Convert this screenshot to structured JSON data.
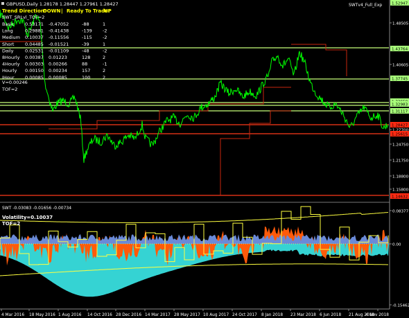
{
  "header": {
    "symbol_line": "GBPUSD,Daily  1.28178 1.28447 1.27961 1.28427",
    "trend_label": "Trend Direction:",
    "trend_value": "DOWN",
    "separator": "|",
    "ready_label": "Ready To Trade:",
    "ready_value": "UP",
    "indicator_name": "SWTv4_Full_Exp"
  },
  "info_panel": {
    "title": "SWT_SRLvl_TOF=2",
    "rows": [
      {
        "label": "Basic",
        "v1": "0.53171",
        "v2": "-0.47052",
        "v3": "-88",
        "v4": "1"
      },
      {
        "label": "Long",
        "v1": "0.29881",
        "v2": "-0.41438",
        "v3": "-139",
        "v4": "-2"
      },
      {
        "label": "Medium",
        "v1": "0.10037",
        "v2": "-0.11556",
        "v3": "-115",
        "v4": "-2"
      },
      {
        "label": "Short",
        "v1": "0.04485",
        "v2": "-0.01521",
        "v3": "-39",
        "v4": "1"
      },
      {
        "label": "Daily",
        "v1": "0.02531",
        "v2": "-0.01109",
        "v3": "-48",
        "v4": "-2"
      },
      {
        "label": "8Hourly",
        "v1": "0.00387",
        "v2": "0.01223",
        "v3": "128",
        "v4": "2"
      },
      {
        "label": "4Hourly",
        "v1": "0.00303",
        "v2": "0.00266",
        "v3": "88",
        "v4": "-1"
      },
      {
        "label": "Hourly",
        "v1": "0.00150",
        "v2": "0.00234",
        "v3": "157",
        "v4": "2"
      },
      {
        "label": "IHour",
        "v1": "0.00085",
        "v2": "0.00085",
        "v3": "100",
        "v4": "2"
      }
    ],
    "v_line": "V=0.00246",
    "tof_line": "TOF=2"
  },
  "price_axis": {
    "labels": [
      "1.52947",
      "1.48505",
      "1.43764",
      "1.40605",
      "1.37745",
      "1.33650",
      "1.32983",
      "1.31117",
      "1.28427",
      "1.27700",
      "1.25615",
      "1.24750",
      "1.21750",
      "1.18800",
      "1.15800",
      "1.14632"
    ],
    "current_price": "1.28427"
  },
  "sub_window": {
    "title_line": "SWT -0.03083 -0.01656 -0.00734",
    "volatility_line": "Volatility=0.10037",
    "tof_line": "TOF=2",
    "axis_labels": [
      "0.08377",
      "0.00",
      "-0.15462"
    ]
  },
  "time_axis": {
    "labels": [
      "4 Mar 2016",
      "18 May 2016",
      "1 Aug 2016",
      "14 Oct 2016",
      "28 Dec 2016",
      "14 Mar 2017",
      "28 May 2017",
      "10 Aug 2017",
      "24 Oct 2017",
      "8 Jan 2018",
      "23 Mar 2018",
      "6 Jun 2018",
      "21 Aug 2018",
      "4 Nov 2018"
    ]
  },
  "colors": {
    "background": "#000000",
    "price": "#00ff00",
    "support_line": "#c8ff7a",
    "current_line": "#ff3a1a",
    "stop_line": "#c8260e",
    "header_trend": "#ffff00",
    "osc_orange": "#ff5a0a",
    "osc_cyan": "#35d3d3",
    "osc_blue": "#6a8ad8",
    "osc_band": "#ffff40",
    "label_bg_green": "#a8ff7a",
    "label_bg_red": "#ff2a12"
  }
}
